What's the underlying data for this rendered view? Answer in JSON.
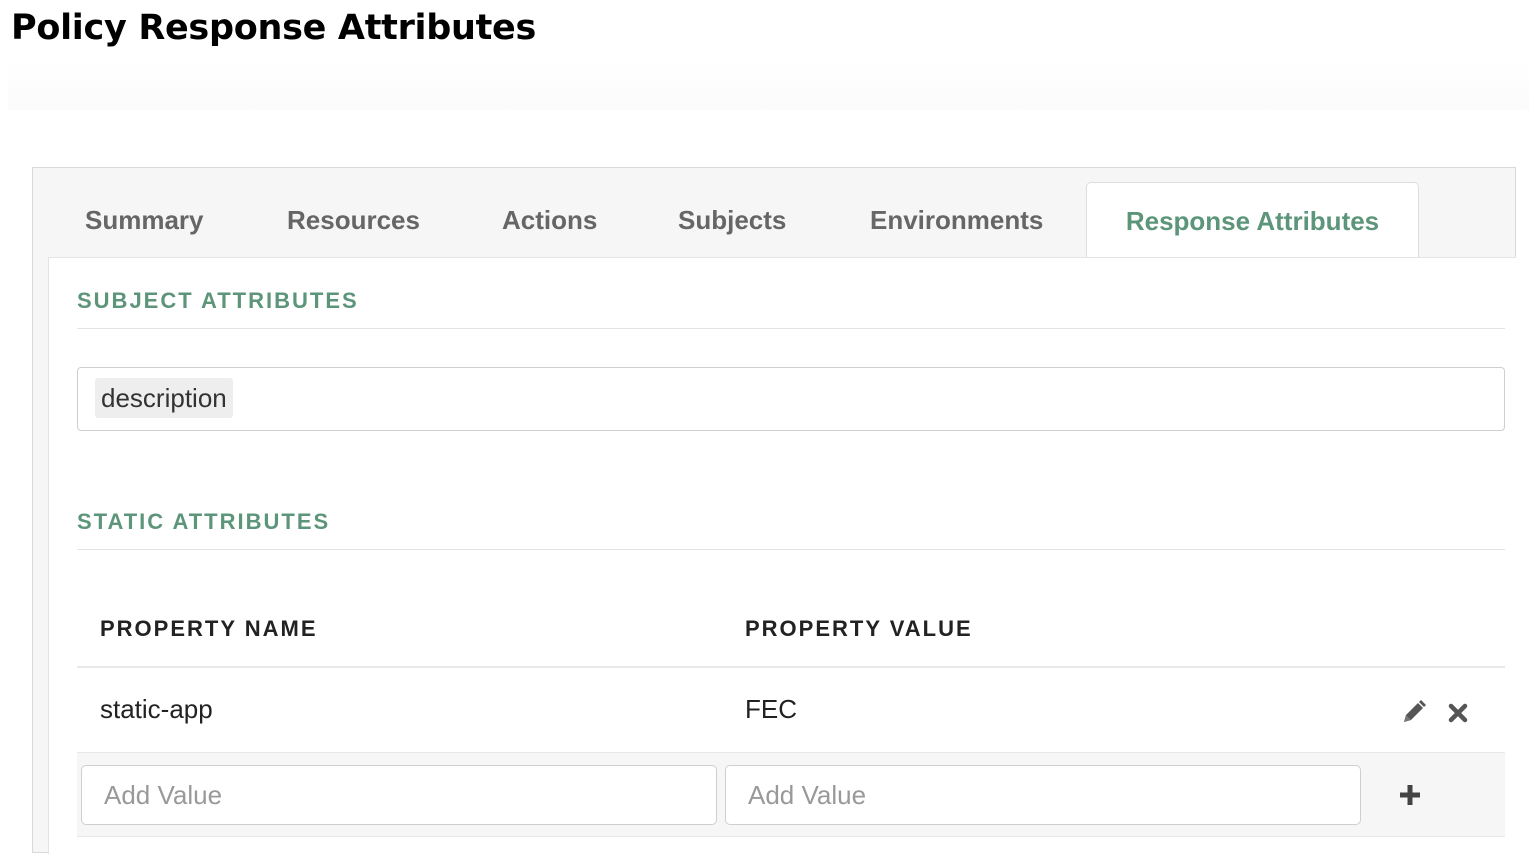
{
  "page": {
    "title": "Policy Response Attributes"
  },
  "tabs": [
    {
      "label": "Summary",
      "active": false
    },
    {
      "label": "Resources",
      "active": false
    },
    {
      "label": "Actions",
      "active": false
    },
    {
      "label": "Subjects",
      "active": false
    },
    {
      "label": "Environments",
      "active": false
    },
    {
      "label": "Response Attributes",
      "active": true
    }
  ],
  "subject_attributes": {
    "title": "SUBJECT ATTRIBUTES",
    "tags": [
      "description"
    ]
  },
  "static_attributes": {
    "title": "STATIC ATTRIBUTES",
    "columns": {
      "name": "PROPERTY NAME",
      "value": "PROPERTY VALUE"
    },
    "rows": [
      {
        "name": "static-app",
        "value": "FEC"
      }
    ],
    "new_row": {
      "name_placeholder": "Add Value",
      "value_placeholder": "Add Value"
    },
    "actions": {
      "edit_icon": "pencil-icon",
      "delete_icon": "close-icon",
      "add_icon": "plus-icon"
    }
  },
  "colors": {
    "accent": "#5d957a",
    "tab_inactive": "#666666",
    "panel_bg": "#f6f6f6"
  }
}
